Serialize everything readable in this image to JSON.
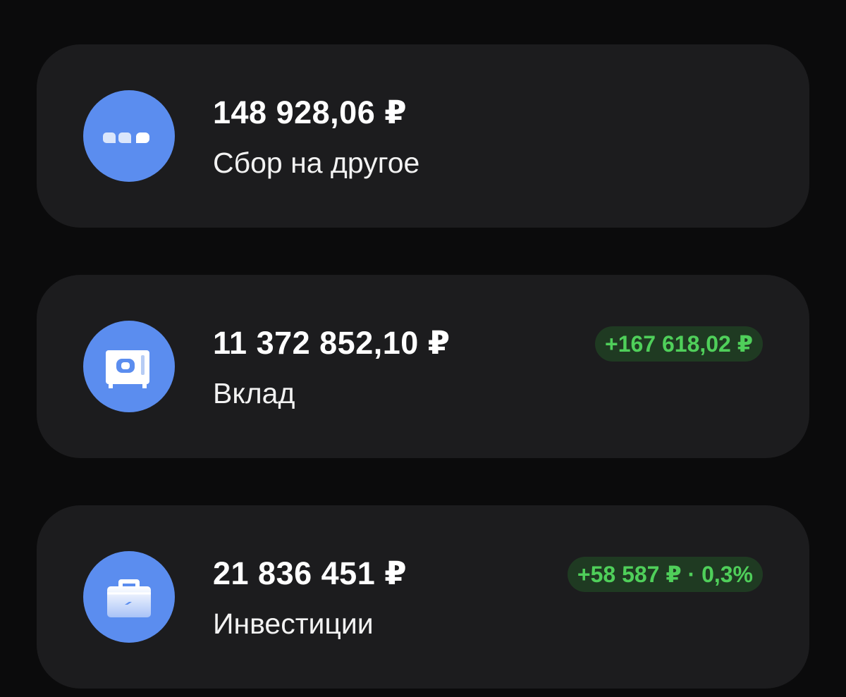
{
  "accounts": [
    {
      "amount": "148 928,06 ₽",
      "label": "Сбор на другое",
      "icon": "chat-bubbles-icon",
      "badge": null
    },
    {
      "amount": "11 372 852,10 ₽",
      "label": "Вклад",
      "icon": "safe-icon",
      "badge": "+167 618,02 ₽"
    },
    {
      "amount": "21 836 451 ₽",
      "label": "Инвестиции",
      "icon": "briefcase-icon",
      "badge": "+58 587 ₽ · 0,3%"
    }
  ],
  "colors": {
    "background": "#0b0b0c",
    "card": "#1c1c1e",
    "icon_accent": "#5b8def",
    "badge_bg": "#1f3a22",
    "badge_text": "#4fcf5a"
  }
}
